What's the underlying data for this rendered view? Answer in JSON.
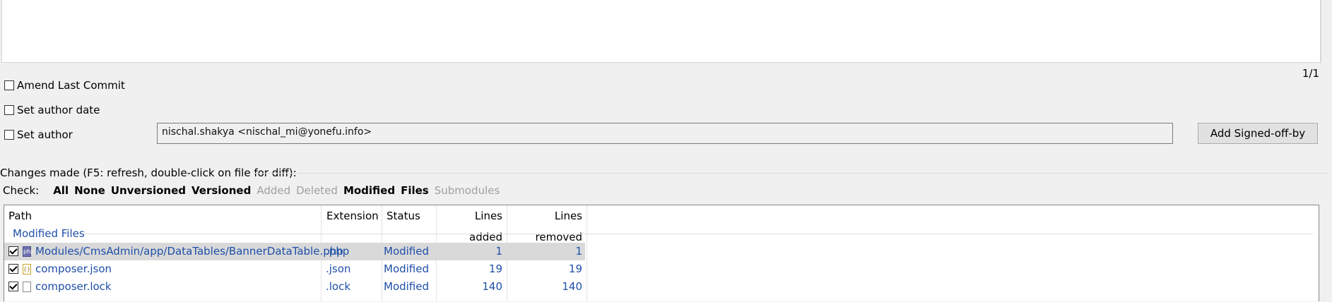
{
  "commit": {
    "counter": "1/1",
    "amend_label": "Amend Last Commit",
    "author_date_label": "Set author date",
    "author_label": "Set author",
    "author_value": "nischal.shakya <nischal_mi@yonefu.info>",
    "signed_off_label": "Add Signed-off-by"
  },
  "changes": {
    "group_label": "Changes made (F5: refresh, double-click on file for diff):",
    "check_label": "Check:",
    "filters": [
      {
        "label": "All",
        "enabled": true
      },
      {
        "label": "None",
        "enabled": true
      },
      {
        "label": "Unversioned",
        "enabled": true
      },
      {
        "label": "Versioned",
        "enabled": true
      },
      {
        "label": "Added",
        "enabled": false
      },
      {
        "label": "Deleted",
        "enabled": false
      },
      {
        "label": "Modified",
        "enabled": true
      },
      {
        "label": "Files",
        "enabled": true
      },
      {
        "label": "Submodules",
        "enabled": false
      }
    ],
    "columns": [
      "Path",
      "Extension",
      "Status",
      "Lines added",
      "Lines removed"
    ],
    "group_name": "Modified Files",
    "rows": [
      {
        "path": "Modules/CmsAdmin/app/DataTables/BannerDataTable.php",
        "ext": ".php",
        "status": "Modified",
        "added": "1",
        "removed": "1",
        "checked": true,
        "icon": "php-file-icon"
      },
      {
        "path": "composer.json",
        "ext": ".json",
        "status": "Modified",
        "added": "19",
        "removed": "19",
        "checked": true,
        "icon": "json-file-icon"
      },
      {
        "path": "composer.lock",
        "ext": ".lock",
        "status": "Modified",
        "added": "140",
        "removed": "140",
        "checked": true,
        "icon": "generic-file-icon"
      }
    ]
  }
}
